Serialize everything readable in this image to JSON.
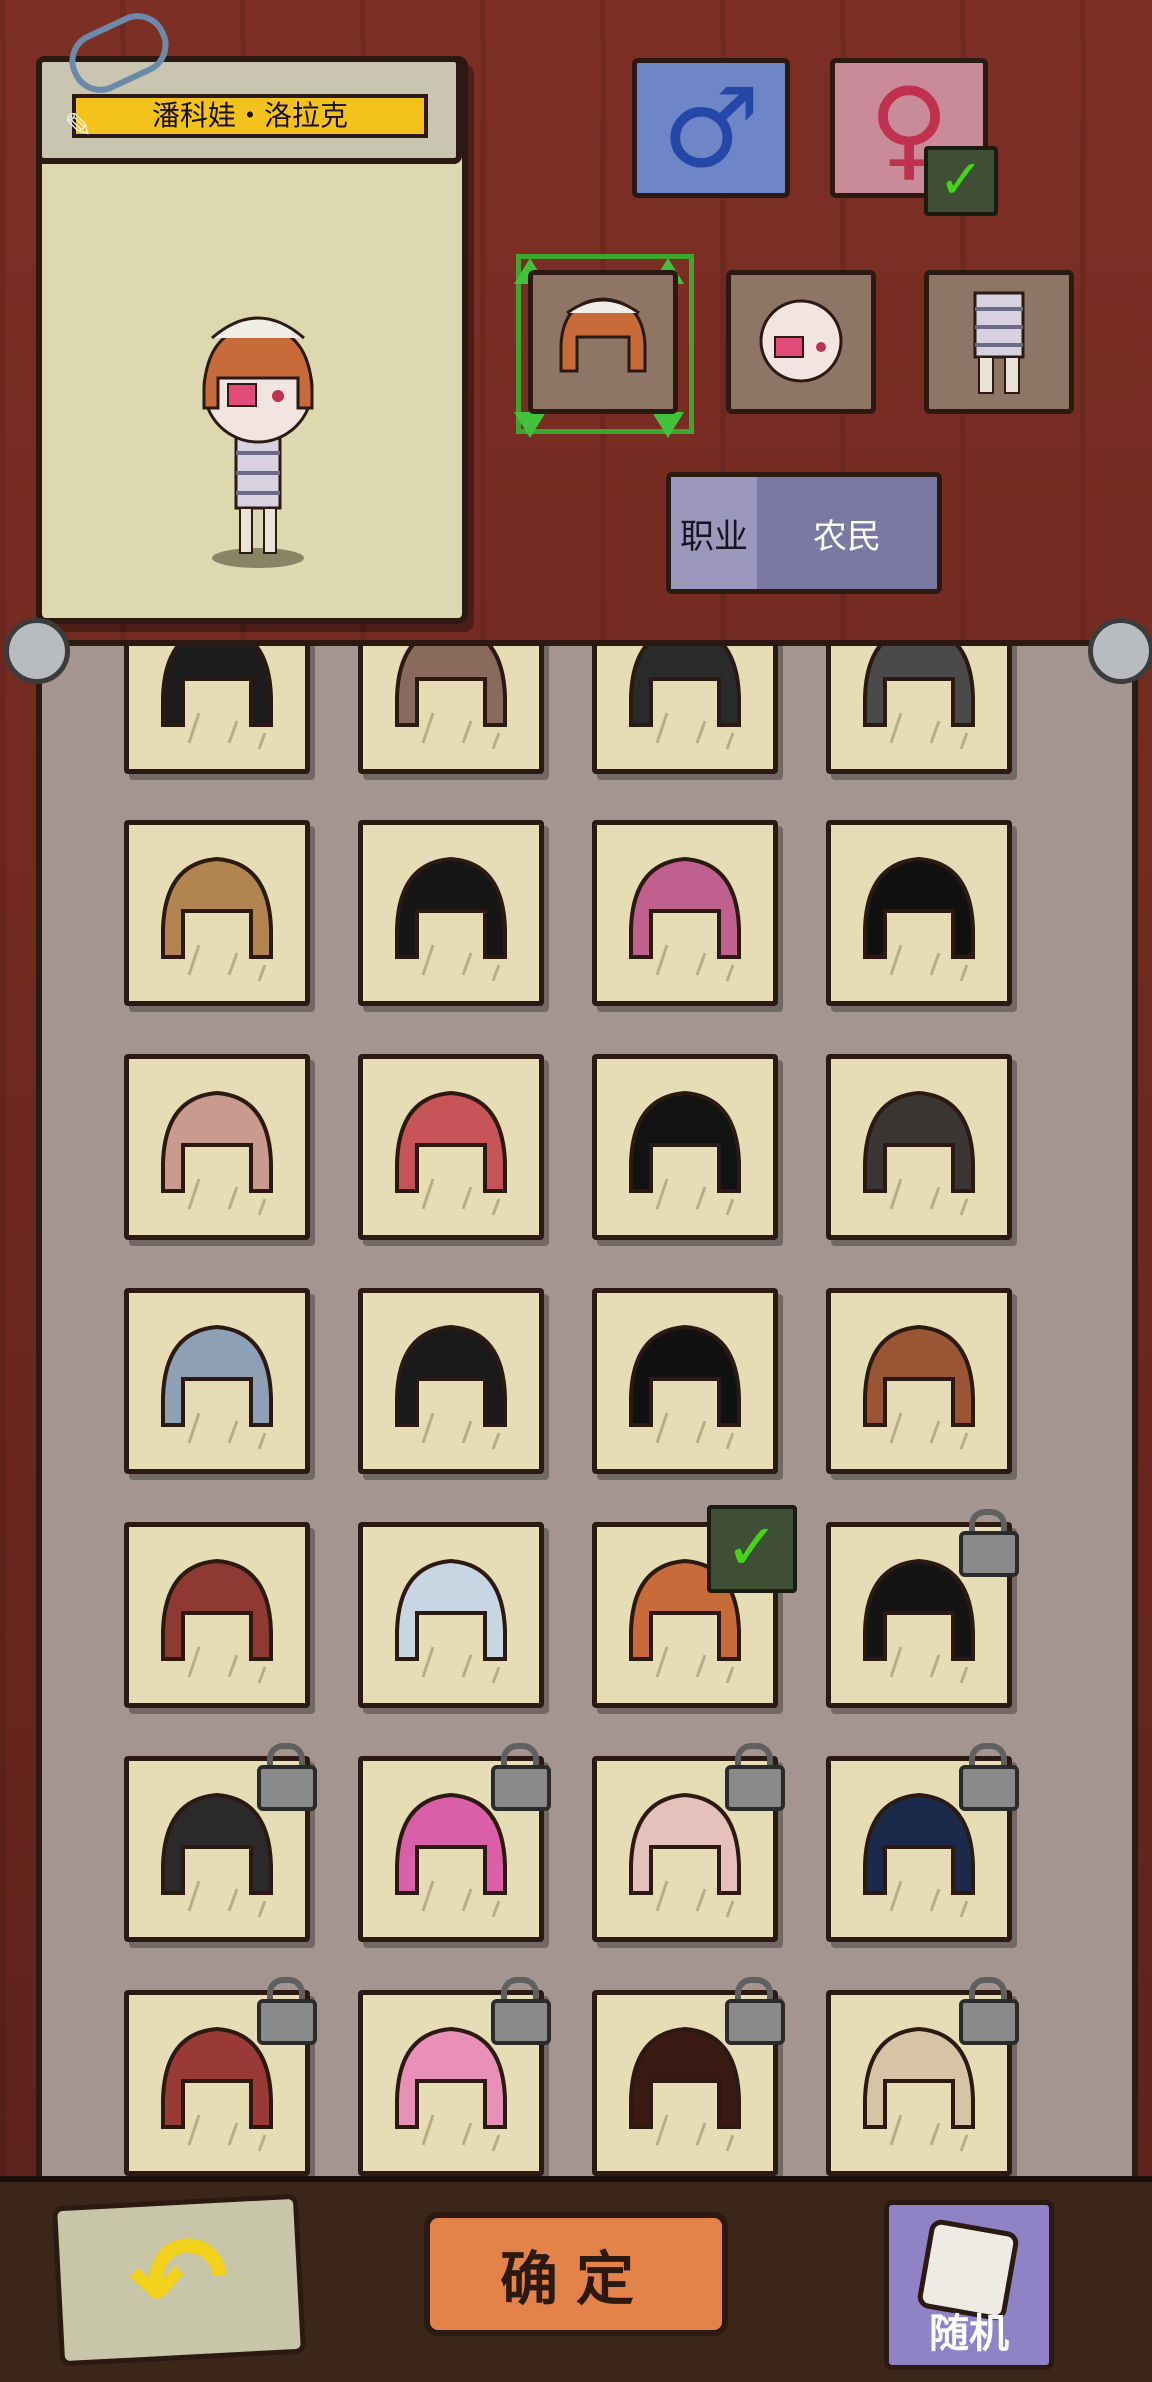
{
  "character": {
    "name": "潘科娃・洛拉克"
  },
  "gender": {
    "male_icon": "male-symbol-icon",
    "female_icon": "female-symbol-icon",
    "male_glyph": "♂",
    "female_glyph": "♀",
    "selected": "female"
  },
  "categories": [
    {
      "name": "hair",
      "selected": true
    },
    {
      "name": "face",
      "selected": false
    },
    {
      "name": "outfit",
      "selected": false
    }
  ],
  "occupation": {
    "label": "职业",
    "value": "农民"
  },
  "hair_items": {
    "selected_index": 18,
    "locked_indices": [
      19,
      20,
      21,
      22,
      23,
      24,
      25,
      26,
      27
    ]
  },
  "buttons": {
    "back_glyph": "↶",
    "confirm_label": "确定",
    "random_label": "随机"
  },
  "colors": {
    "selection": "#3ea62f",
    "name_bar": "#f3c21c",
    "confirm": "#e3834a",
    "random": "#8f83c6"
  }
}
